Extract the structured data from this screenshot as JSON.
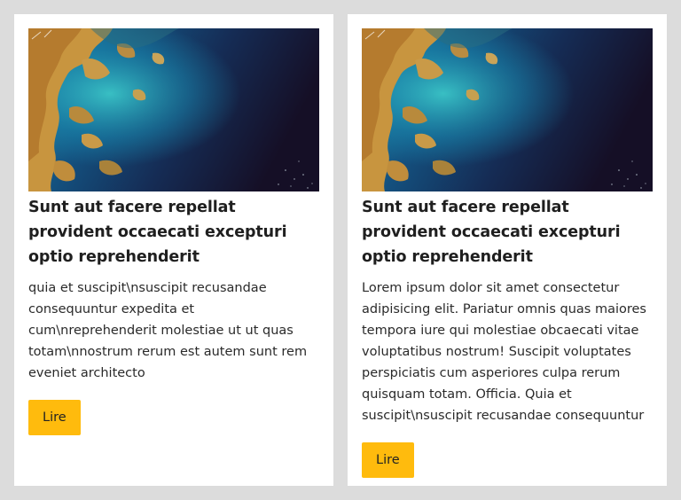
{
  "cards": [
    {
      "image_alt": "satellite-image-coastline",
      "title": "Sunt aut facere repellat provident occaecati excepturi optio reprehenderit",
      "body": "quia et suscipit\\nsuscipit recusandae consequuntur expedita et cum\\nreprehenderit molestiae ut ut quas totam\\nnostrum rerum est autem sunt rem eveniet architecto",
      "button_label": "Lire"
    },
    {
      "image_alt": "satellite-image-coastline",
      "title": "Sunt aut facere repellat provident occaecati excepturi optio reprehenderit",
      "body": "Lorem ipsum dolor sit amet consectetur adipisicing elit. Pariatur omnis quas maiores tempora iure qui molestiae obcaecati vitae voluptatibus nostrum! Suscipit voluptates perspiciatis cum asperiores culpa rerum quisquam totam. Officia. Quia et suscipit\\nsuscipit recusandae consequuntur",
      "button_label": "Lire"
    }
  ],
  "colors": {
    "page_background": "#dcdcdc",
    "card_background": "#ffffff",
    "button_background": "#ffbb0d"
  }
}
